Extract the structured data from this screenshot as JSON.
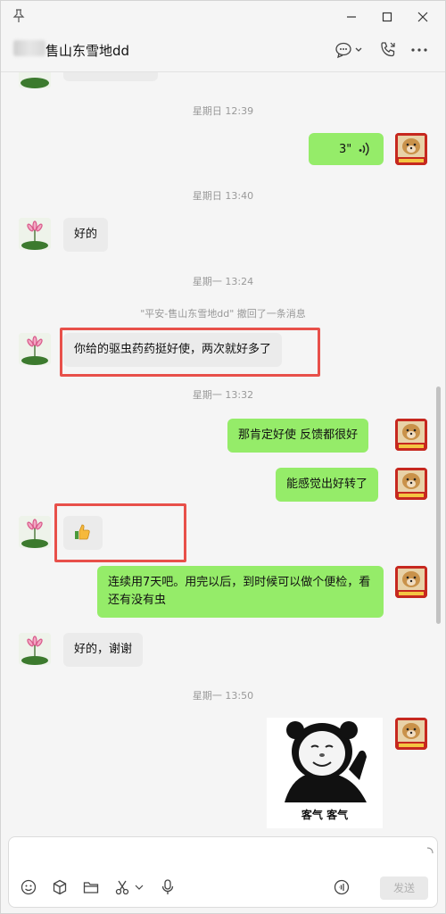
{
  "window": {
    "title_blurred": true
  },
  "header": {
    "chat_name": "售山东雪地dd"
  },
  "messages": [
    {
      "type": "time",
      "text": "星期日 12:39"
    },
    {
      "type": "voice",
      "side": "right",
      "duration": "3\""
    },
    {
      "type": "time",
      "text": "星期日 13:40"
    },
    {
      "type": "text",
      "side": "left",
      "text": "好的"
    },
    {
      "type": "time",
      "text": "星期一 13:24"
    },
    {
      "type": "system",
      "text": "\"平安-售山东雪地dd\" 撤回了一条消息"
    },
    {
      "type": "text",
      "side": "left",
      "text": "你给的驱虫药药挺好使，两次就好多了",
      "highlighted": true
    },
    {
      "type": "time",
      "text": "星期一 13:32"
    },
    {
      "type": "text",
      "side": "right",
      "text": "那肯定好使   反馈都很好"
    },
    {
      "type": "text",
      "side": "right",
      "text": "能感觉出好转了"
    },
    {
      "type": "emoji",
      "side": "left",
      "emoji": "👍",
      "highlighted": true
    },
    {
      "type": "text",
      "side": "right",
      "text": "连续用7天吧。用完以后，到时候可以做个便检，看还有没有虫"
    },
    {
      "type": "text",
      "side": "left",
      "text": "好的，谢谢"
    },
    {
      "type": "time",
      "text": "星期一 13:50"
    },
    {
      "type": "sticker",
      "side": "right",
      "caption": "客气 客气"
    }
  ],
  "input": {
    "send_label": "发送"
  },
  "colors": {
    "accent_green": "#95ec69",
    "highlight_red": "#e8504a",
    "bubble_gray": "#ebebeb"
  },
  "icons": [
    "pin-icon",
    "minimize-icon",
    "maximize-icon",
    "close-icon",
    "chat-bubble-icon",
    "phone-icon",
    "more-icon",
    "emoji-icon",
    "box-icon",
    "folder-icon",
    "scissors-icon",
    "mic-icon",
    "voice-input-icon"
  ]
}
